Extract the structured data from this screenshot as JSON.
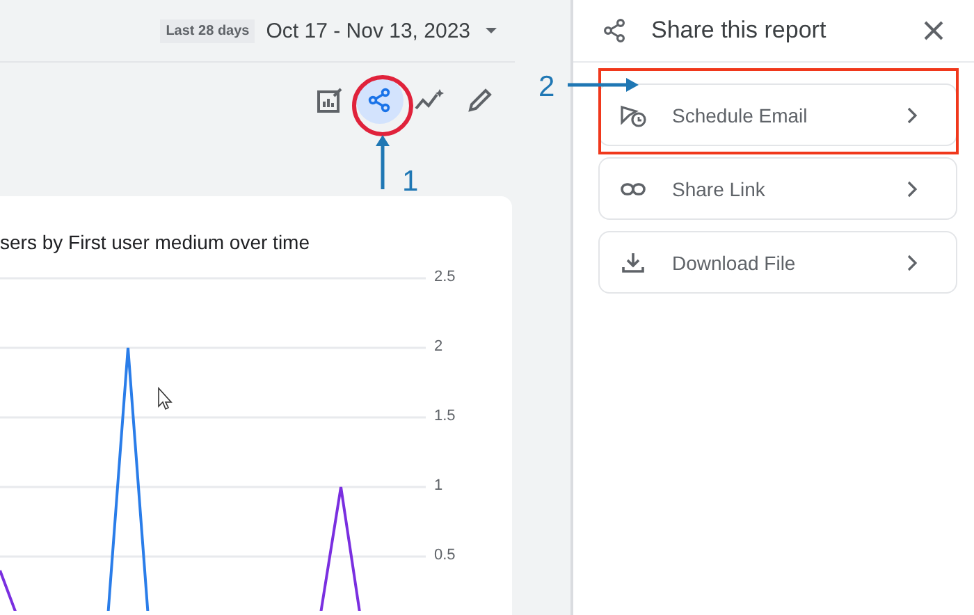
{
  "date_range": {
    "preset": "Last 28 days",
    "range": "Oct 17 - Nov 13, 2023"
  },
  "toolbar": [
    {
      "kind": "customize",
      "selected": false
    },
    {
      "kind": "share",
      "selected": true
    },
    {
      "kind": "insights",
      "selected": false
    },
    {
      "kind": "edit",
      "selected": false
    }
  ],
  "card": {
    "title": "sers by First user medium over time",
    "y_axis_labels": [
      "2.5",
      "2",
      "1.5",
      "1",
      "0.5"
    ]
  },
  "share_panel": {
    "title": "Share this report",
    "options": [
      {
        "kind": "schedule",
        "label": "Schedule Email"
      },
      {
        "kind": "link",
        "label": "Share Link"
      },
      {
        "kind": "download",
        "label": "Download File"
      }
    ]
  },
  "annotations": [
    {
      "number": "1"
    },
    {
      "number": "2"
    }
  ]
}
